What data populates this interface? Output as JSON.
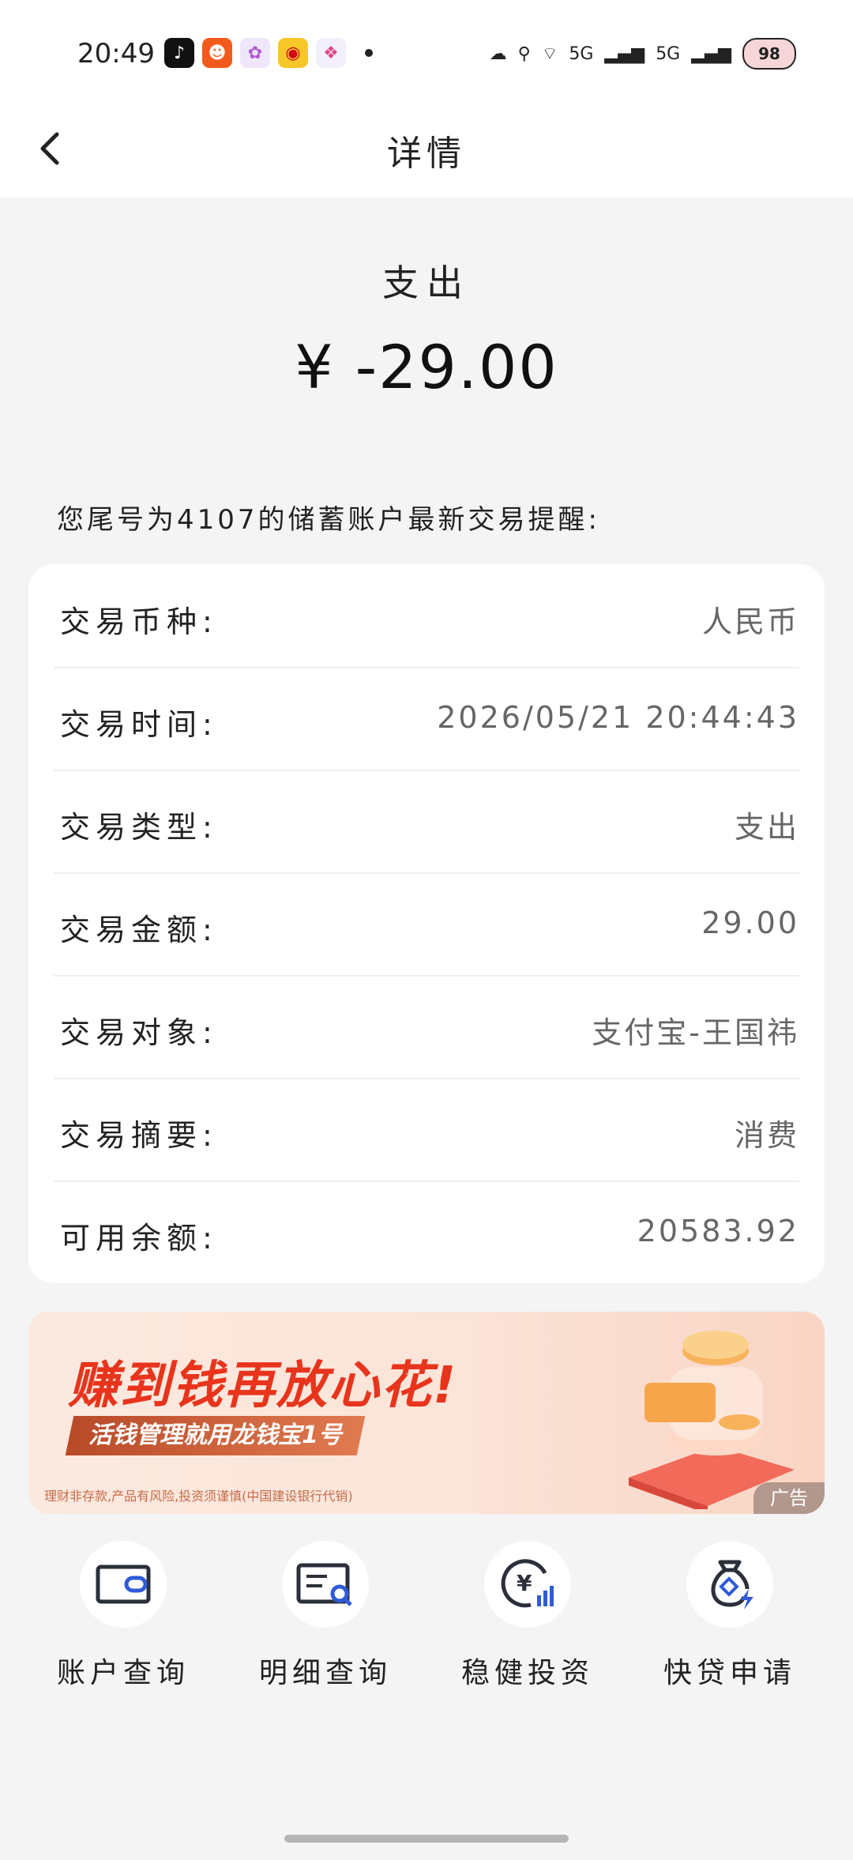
{
  "status_bar": {
    "time": "20:49",
    "network_labels": [
      "5G",
      "5G"
    ],
    "battery": "98"
  },
  "header": {
    "title": "详情",
    "back_icon": "chevron-left-icon"
  },
  "summary": {
    "type": "支出",
    "amount": "¥ -29.00"
  },
  "notice": "您尾号为4107的储蓄账户最新交易提醒:",
  "details": [
    {
      "label": "交易币种:",
      "value": "人民币"
    },
    {
      "label": "交易时间:",
      "value": "2026/05/21 20:44:43"
    },
    {
      "label": "交易类型:",
      "value": "支出"
    },
    {
      "label": "交易金额:",
      "value": "29.00"
    },
    {
      "label": "交易对象:",
      "value": "支付宝-王国祎"
    },
    {
      "label": "交易摘要:",
      "value": "消费"
    },
    {
      "label": "可用余额:",
      "value": "20583.92"
    }
  ],
  "banner": {
    "headline": "赚到钱再放心花!",
    "subline": "活钱管理就用龙钱宝1号",
    "disclaimer": "理财非存款,产品有风险,投资须谨慎(中国建设银行代销)",
    "ad_tag": "广告"
  },
  "quick_actions": [
    {
      "label": "账户查询",
      "icon": "wallet-icon"
    },
    {
      "label": "明细查询",
      "icon": "search-list-icon"
    },
    {
      "label": "稳健投资",
      "icon": "yuan-chart-icon"
    },
    {
      "label": "快贷申请",
      "icon": "money-bag-icon"
    }
  ],
  "colors": {
    "accent_red": "#e8341c",
    "icon_dark": "#2b2f3a",
    "icon_blue": "#2f5bd8"
  }
}
